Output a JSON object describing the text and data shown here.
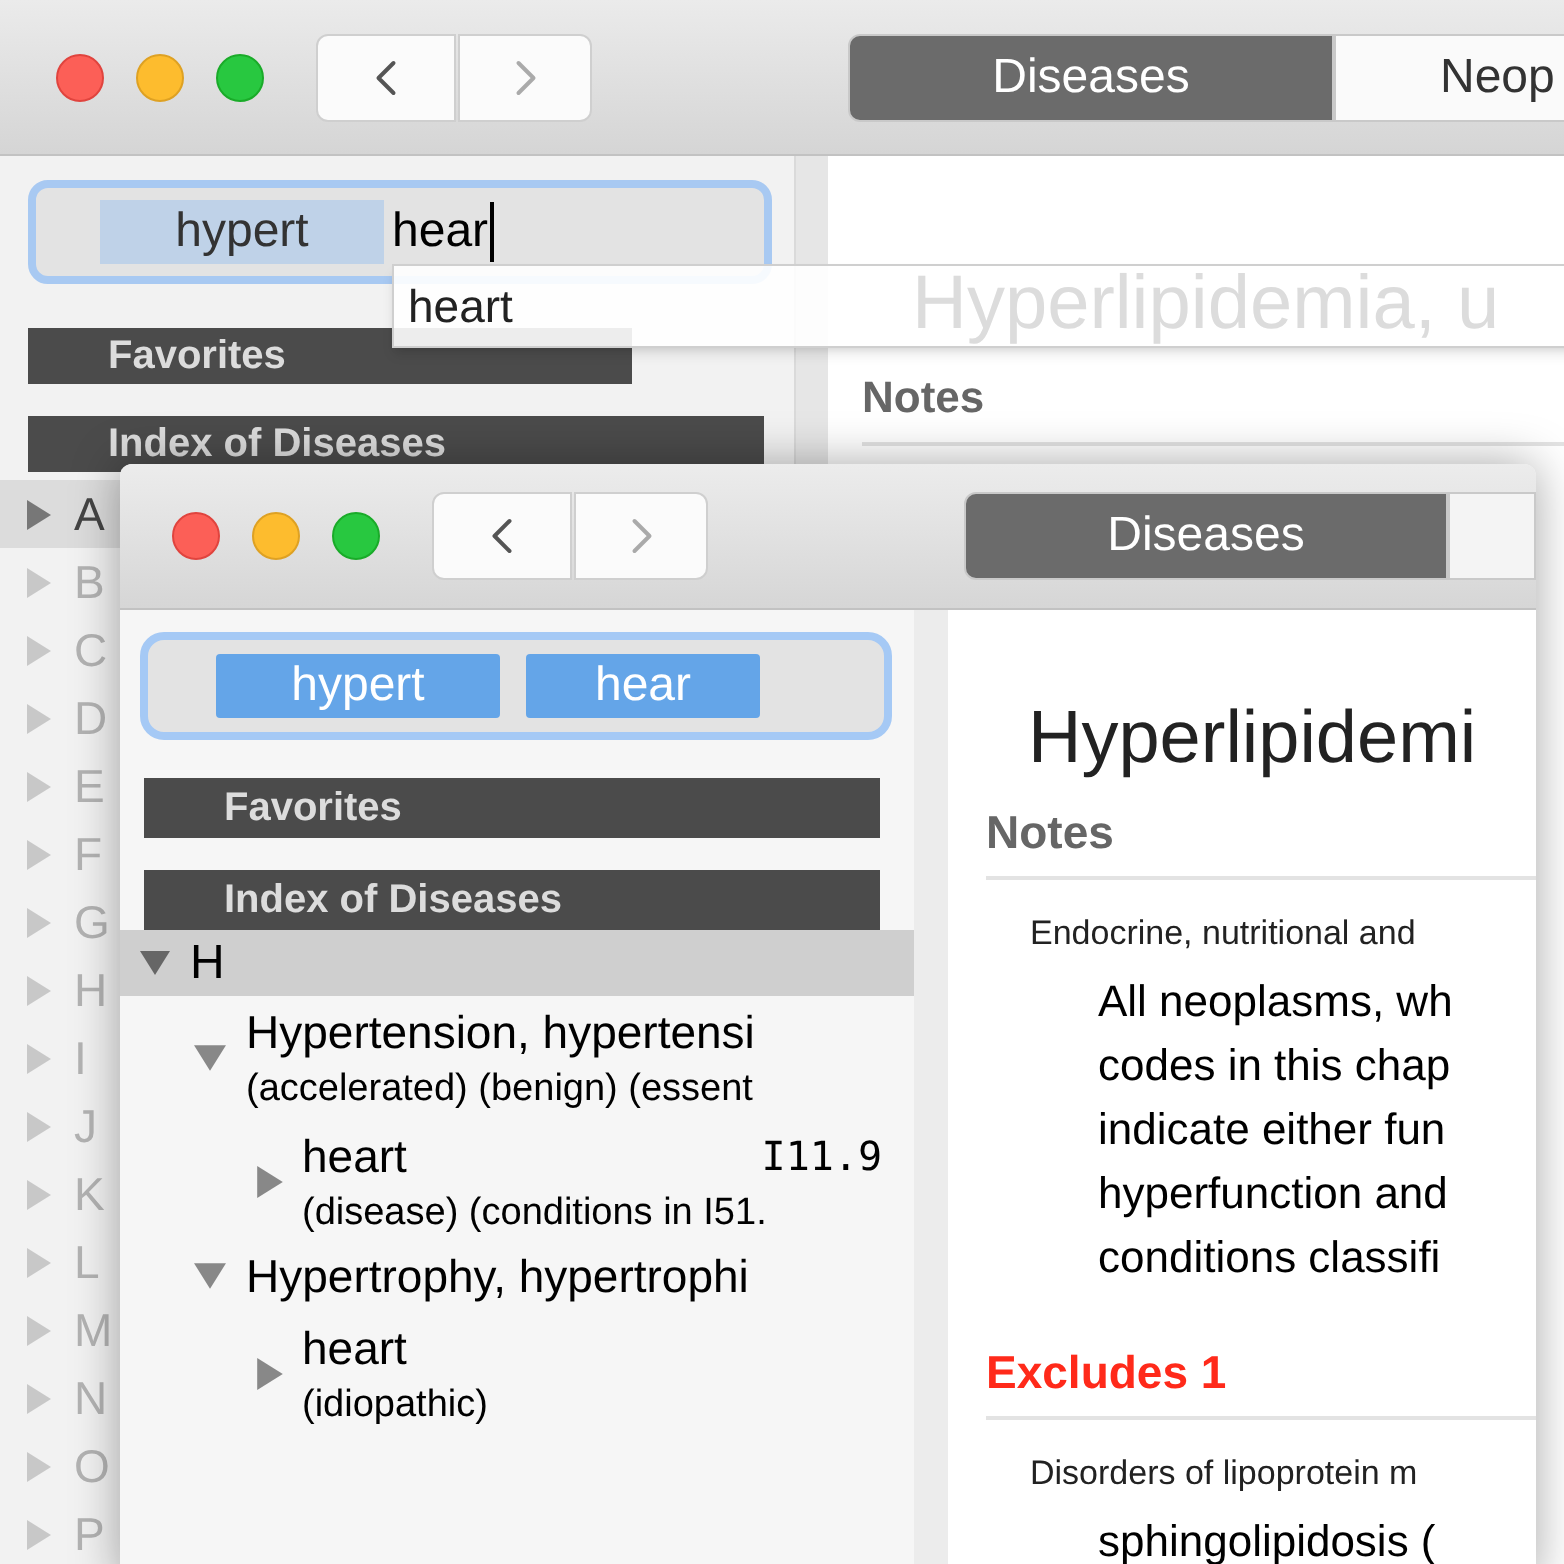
{
  "back_window": {
    "tabs": [
      {
        "label": "Diseases",
        "selected": true
      },
      {
        "label": "Neop",
        "selected": false
      }
    ],
    "search": {
      "tokens": [
        "hypert"
      ],
      "value": "hear"
    },
    "suggestions": [
      "heart"
    ],
    "sidebar_sections": [
      "Favorites",
      "Index of Diseases"
    ],
    "letters": [
      {
        "label": "A",
        "selected": true
      },
      {
        "label": "B",
        "selected": false
      },
      {
        "label": "C",
        "selected": false
      },
      {
        "label": "D",
        "selected": false
      },
      {
        "label": "E",
        "selected": false
      },
      {
        "label": "F",
        "selected": false
      },
      {
        "label": "G",
        "selected": false
      },
      {
        "label": "H",
        "selected": false
      },
      {
        "label": "I",
        "selected": false
      },
      {
        "label": "J",
        "selected": false
      },
      {
        "label": "K",
        "selected": false
      },
      {
        "label": "L",
        "selected": false
      },
      {
        "label": "M",
        "selected": false
      },
      {
        "label": "N",
        "selected": false
      },
      {
        "label": "O",
        "selected": false
      },
      {
        "label": "P",
        "selected": false
      }
    ],
    "content": {
      "title": "Hyperlipidemia, u",
      "heading": "Notes"
    }
  },
  "front_window": {
    "tabs": [
      {
        "label": "Diseases",
        "selected": true
      }
    ],
    "search": {
      "tokens": [
        "hypert",
        "hear"
      ]
    },
    "sidebar_sections": [
      "Favorites",
      "Index of Diseases"
    ],
    "tree": [
      {
        "label": "H",
        "expanded": true,
        "children": [
          {
            "title": "Hypertension, hypertensi",
            "subtitle": "(accelerated) (benign) (essent",
            "expanded": true,
            "children": [
              {
                "title": "heart",
                "code": "I11.9",
                "subtitle": "(disease) (conditions in I51.",
                "expanded": false
              }
            ]
          },
          {
            "title": "Hypertrophy, hypertrophi",
            "expanded": true,
            "children": [
              {
                "title": "heart",
                "subtitle": "(idiopathic)",
                "expanded": false
              }
            ]
          }
        ]
      }
    ],
    "content": {
      "title": "Hyperlipidemi",
      "sections": [
        {
          "kind": "notes",
          "heading": "Notes",
          "source": "Endocrine, nutritional and",
          "lines": [
            "All neoplasms, wh",
            "codes in this chap",
            "indicate either fun",
            "hyperfunction and",
            "conditions classifi"
          ]
        },
        {
          "kind": "excludes",
          "heading": "Excludes 1",
          "source": "Disorders of lipoprotein m",
          "lines": [
            "sphingolipidosis ("
          ]
        }
      ]
    }
  }
}
